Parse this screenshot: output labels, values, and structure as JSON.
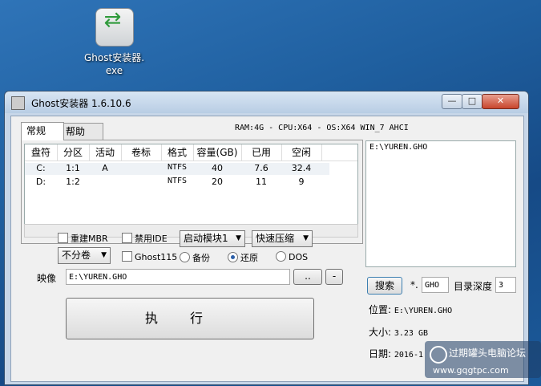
{
  "desktop": {
    "icon_label_line1": "Ghost安装器.",
    "icon_label_line2": "exe"
  },
  "window": {
    "title": "Ghost安装器 1.6.10.6",
    "controls": {
      "min": "—",
      "max": "□",
      "close": "✕"
    }
  },
  "tabs": [
    "常规",
    "帮助"
  ],
  "sysinfo": "RAM:4G - CPU:X64 - OS:X64 WIN_7 AHCI",
  "partitions": {
    "headers": [
      "盘符",
      "分区",
      "活动",
      "卷标",
      "格式",
      "容量(GB)",
      "已用",
      "空闲"
    ],
    "rows": [
      [
        "C:",
        "1:1",
        "A",
        "",
        "NTFS",
        "40",
        "7.6",
        "32.4"
      ],
      [
        "D:",
        "1:2",
        "",
        "",
        "NTFS",
        "20",
        "11",
        "9"
      ]
    ]
  },
  "options": {
    "rebuild_mbr": "重建MBR",
    "disable_ide": "禁用IDE",
    "boot_module": "启动模块1",
    "compression": "快速压缩",
    "split": "不分卷",
    "ghost115": "Ghost115",
    "mode_backup": "备份",
    "mode_restore": "还原",
    "mode_dos": "DOS"
  },
  "image": {
    "label": "映像",
    "path": "E:\\YUREN.GHO",
    "browse": "..",
    "minus": "-"
  },
  "execute_label": "执行",
  "filelist": [
    "E:\\YUREN.GHO"
  ],
  "search": {
    "button": "搜索",
    "ext_prefix": "*.",
    "ext": "GHO",
    "depth_label": "目录深度",
    "depth": "3"
  },
  "file_info": {
    "location_label": "位置:",
    "location": "E:\\YUREN.GHO",
    "size_label": "大小:",
    "size": "3.23 GB",
    "date_label": "日期:",
    "date": "2016-1"
  },
  "watermark": {
    "line1": "过期罐头电脑论坛",
    "line2": "www.gqgtpc.com"
  }
}
